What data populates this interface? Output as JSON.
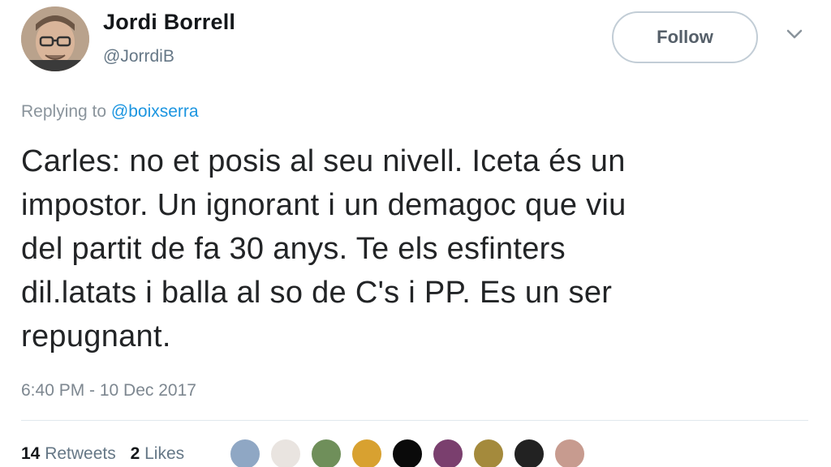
{
  "user": {
    "display_name": "Jordi Borrell",
    "handle": "@JorrdiB"
  },
  "actions": {
    "follow_label": "Follow"
  },
  "reply": {
    "prefix": "Replying to ",
    "mention": "@boixserra"
  },
  "tweet": {
    "text_lines": [
      "Carles: no et posis al seu nivell. Iceta és un",
      "impostor. Un ignorant i un demagoc que viu",
      "del partit de fa 30 anys. Te els esfinters",
      "dil.latats i balla al so de C's i PP. Es un ser",
      "repugnant."
    ],
    "timestamp": "6:40 PM - 10 Dec 2017"
  },
  "stats": {
    "retweets_count": "14",
    "retweets_label": "Retweets",
    "likes_count": "2",
    "likes_label": "Likes"
  },
  "likers": [
    {
      "color": "#8fa7c4"
    },
    {
      "color": "#e9e4e0"
    },
    {
      "color": "#6f8f5a"
    },
    {
      "color": "#d8a130"
    },
    {
      "color": "#0a0a0a"
    },
    {
      "color": "#7a3f6e"
    },
    {
      "color": "#a48a3c"
    },
    {
      "color": "#222222"
    },
    {
      "color": "#c79b8f"
    }
  ],
  "colors": {
    "text": "#222426",
    "secondary": "#657786",
    "link": "#1b95e0",
    "border": "#c2cdd6"
  }
}
